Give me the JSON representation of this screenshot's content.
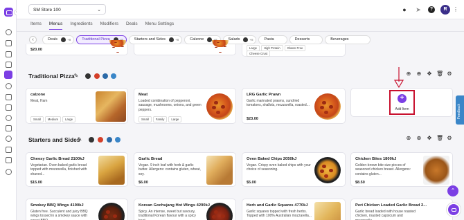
{
  "topbar": {
    "store_name": "SM Store 100",
    "avatar_initial": "R",
    "chevron": "⌄",
    "help": "?"
  },
  "nav_tabs": [
    "Items",
    "Menus",
    "Ingredients",
    "Modifiers",
    "Deals",
    "Menu Settings"
  ],
  "categories": [
    {
      "label": "Deals",
      "count": "+8"
    },
    {
      "label": "Traditional Pizza",
      "count": "+8"
    },
    {
      "label": "Starters and Sides",
      "count": "+8"
    },
    {
      "label": "Calzone",
      "count": "+8"
    },
    {
      "label": "Salads",
      "count": "+8"
    },
    {
      "label": "Pasta",
      "count": ""
    },
    {
      "label": "Desserts",
      "count": ""
    },
    {
      "label": "Beverages",
      "count": ""
    }
  ],
  "top_partial": {
    "price": "$20.00",
    "tags_small": [
      "Large",
      "High Protein",
      "Gluten Free"
    ],
    "cheese_crust": "Cheese Crust"
  },
  "sections": [
    {
      "title": "Traditional Pizza"
    },
    {
      "title": "Starters and Sides"
    }
  ],
  "pizza_items": [
    {
      "title": "calzone",
      "desc": "Meat, Ham",
      "price": "",
      "tags": [
        "Small",
        "Medium",
        "Large"
      ]
    },
    {
      "title": "Meat",
      "desc": "Loaded combination of pepperoni, sausage, mushrooms, onions, and green peppers.",
      "price": "",
      "tags": [
        "Small",
        "Family",
        "Large"
      ]
    },
    {
      "title": "LRG Garlic Prawn",
      "desc": "Garlic marinated prawns, sundried tomatoes, shallots, mozzarella, roasted...",
      "price": "$23.00",
      "tags": []
    }
  ],
  "add_item": {
    "label": "Add Item",
    "plus": "+"
  },
  "starters": [
    {
      "title": "Cheesy Garlic Bread 2100kJ",
      "desc": "Vegetarian. Oven baked garlic bread topped with mozzarella, finished with shaved...",
      "price": "$15.00"
    },
    {
      "title": "Garlic Bread",
      "desc": "Vegan. 9 inch loaf with herb & garlic butter. Allergens: contains gluten, wheat, soy.",
      "price": "$6.00"
    },
    {
      "title": "Oven Baked Chips 2050kJ",
      "desc": "Vegan. Crispy oven baked chips with your choice of seasoning.",
      "price": "$5.00"
    },
    {
      "title": "Chicken Bites 1800kJ",
      "desc": "Golden-brown bite size pieces of seasoned chicken breast. Allergens: contains gluten...",
      "price": "$8.50"
    }
  ],
  "starters_row2": [
    {
      "title": "Smokey BBQ Wings 4190kJ",
      "desc": "Gluten free. Succulent and juicy BBQ wings tossed in a smokey sauce with sweet BBQ..."
    },
    {
      "title": "Korean Gochujang Hot Wings 4290kJ",
      "desc": "Spicy. An intense, sweet but savoury, traditional Korean flavour with a spicy heat..."
    },
    {
      "title": "Herb and Garlic Squares 4770kJ",
      "desc": "Garlic squares topped with fresh herbs. Topped with 100% Australian mozzarella..."
    },
    {
      "title": "Peri Chicken Loaded Garlic Bread 2...",
      "desc": "Garlic bread loaded with house roasted chicken, roasted capsicum and mozzarella..."
    }
  ],
  "feedback_label": "Feedback",
  "colors": {
    "accent": "#7b3fe4",
    "highlight": "#c8102e"
  }
}
